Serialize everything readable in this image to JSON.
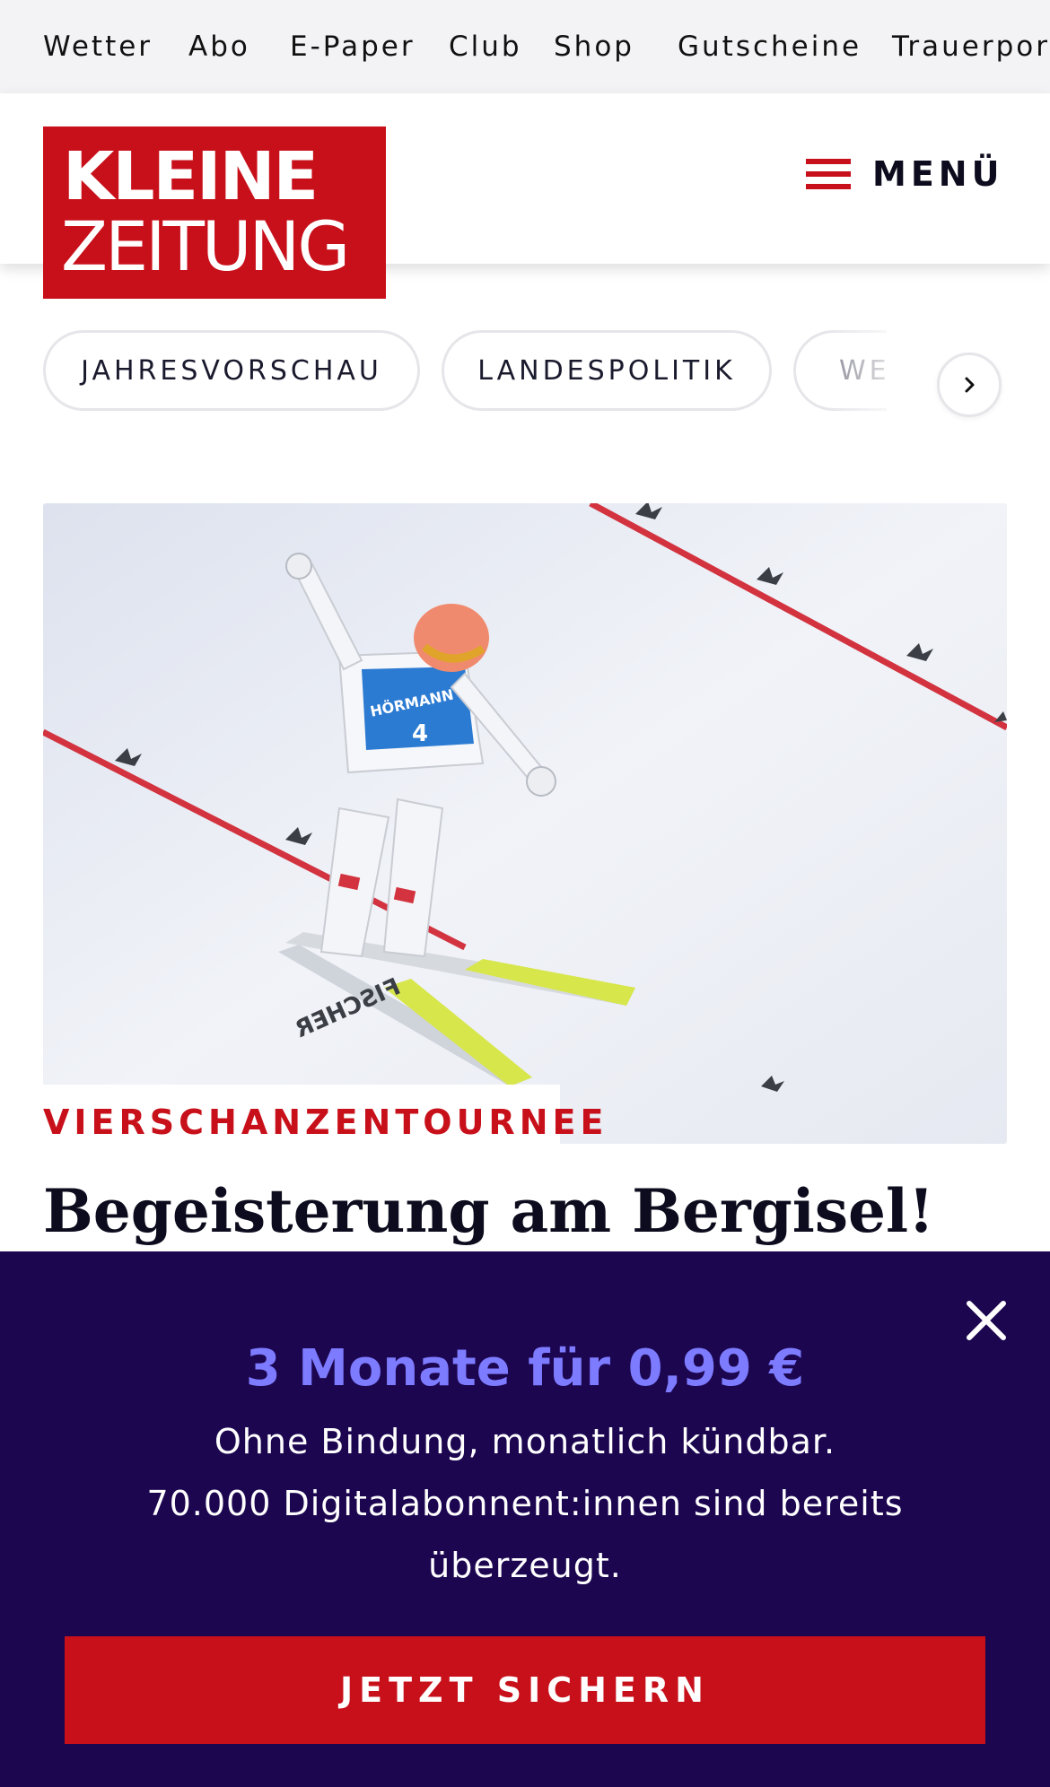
{
  "topbar": {
    "items": [
      "Wetter",
      "Abo",
      "E-Paper",
      "Club",
      "Shop",
      "Gutscheine",
      "Trauerportal"
    ]
  },
  "header": {
    "logo_line1": "KLEINE",
    "logo_line2": "ZEITUNG",
    "menu_label": "MENÜ"
  },
  "chips": {
    "items": [
      "JAHRESVORSCHAU",
      "LANDESPOLITIK",
      "WELT"
    ]
  },
  "article": {
    "kicker": "VIERSCHANZENTOURNEE",
    "headline": "Begeisterung am Bergisel!",
    "bib_sponsor": "HÖRMANN",
    "bib_number": "4",
    "ski_brand": "FISCHER"
  },
  "promo": {
    "offer": "3 Monate für 0,99 €",
    "line1": "Ohne Bindung, monatlich kündbar.",
    "line2": "70.000 Digitalabonnent:innen sind bereits überzeugt.",
    "cta": "JETZT SICHERN"
  },
  "colors": {
    "brand_red": "#c8101b",
    "promo_bg": "#1c0650",
    "promo_accent": "#7d7bff",
    "topbar_bg": "#f3f3f5"
  },
  "icons": {
    "menu": "hamburger-icon",
    "next": "chevron-right-icon",
    "close": "close-icon"
  }
}
